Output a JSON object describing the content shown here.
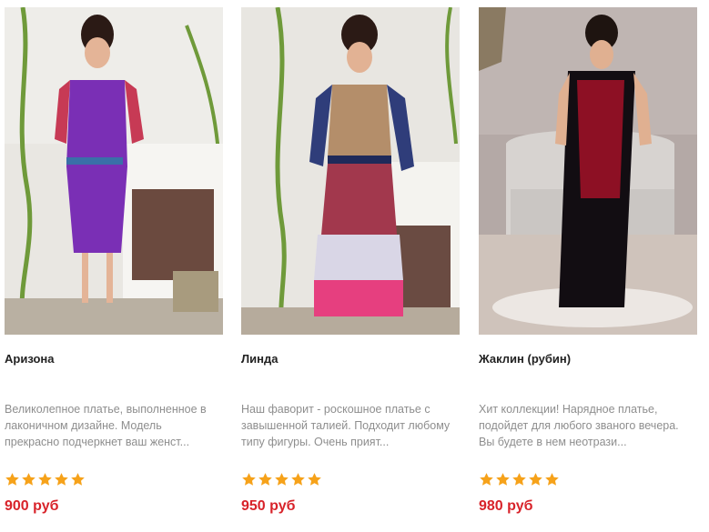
{
  "products": [
    {
      "name": "Аризона",
      "description": "Великолепное платье, выполненное в лаконичном дизайне. Модель прекрасно подчеркнет ваш женст...",
      "rating": 5,
      "price": "900 руб",
      "image_icon": "dress-photo-icon"
    },
    {
      "name": "Линда",
      "description": "Наш фаворит - роскошное платье с завышенной талией. Подходит любому типу фигуры. Очень прият...",
      "rating": 5,
      "price": "950 руб",
      "image_icon": "dress-photo-icon"
    },
    {
      "name": "Жаклин (рубин)",
      "description": "Хит коллекции! Нарядное платье, подойдет для любого званого вечера. Вы будете в нем неотрази...",
      "rating": 5,
      "price": "980 руб",
      "image_icon": "dress-photo-icon"
    }
  ],
  "colors": {
    "price": "#d8232a",
    "star": "#f6a21a",
    "title": "#222222",
    "description": "#8e8e8e"
  }
}
